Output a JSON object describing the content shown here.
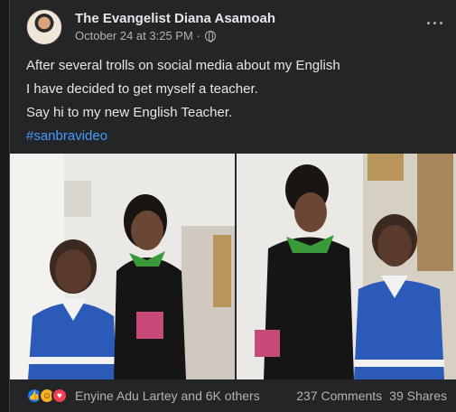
{
  "post": {
    "author": "The Evangelist Diana Asamoah",
    "timestamp": "October 24 at 3:25 PM ·",
    "privacy_icon": "globe-icon",
    "more_label": "···",
    "lines": [
      "After several trolls on social media about my English",
      "I have decided to get myself a teacher.",
      "Say hi to my new English Teacher."
    ],
    "hashtag": "#sanbravideo"
  },
  "reactions": {
    "icons": [
      "like-icon",
      "haha-icon",
      "love-icon"
    ],
    "names": "Enyine Adu Lartey and 6K others",
    "comments": "237 Comments",
    "shares": "39 Shares"
  },
  "colors": {
    "background": "#242526",
    "text": "#e4e6eb",
    "secondary": "#b0b3b8",
    "link": "#4599ff"
  }
}
